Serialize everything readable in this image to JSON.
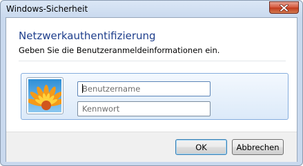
{
  "window": {
    "title": "Windows-Sicherheit",
    "close_icon": "close-icon"
  },
  "header": {
    "heading": "Netzwerkauthentifizierung",
    "subtext": "Geben Sie die Benutzeranmeldeinformationen ein."
  },
  "credentials": {
    "avatar_icon": "flower-user-picture",
    "username": {
      "value": "",
      "placeholder": "Benutzername"
    },
    "password": {
      "value": "",
      "placeholder": "Kennwort"
    }
  },
  "buttons": {
    "ok_label": "OK",
    "cancel_label": "Abbrechen"
  },
  "colors": {
    "heading": "#1e3e8c",
    "close_button": "#c74a2e",
    "tile_border": "#84acdd"
  }
}
